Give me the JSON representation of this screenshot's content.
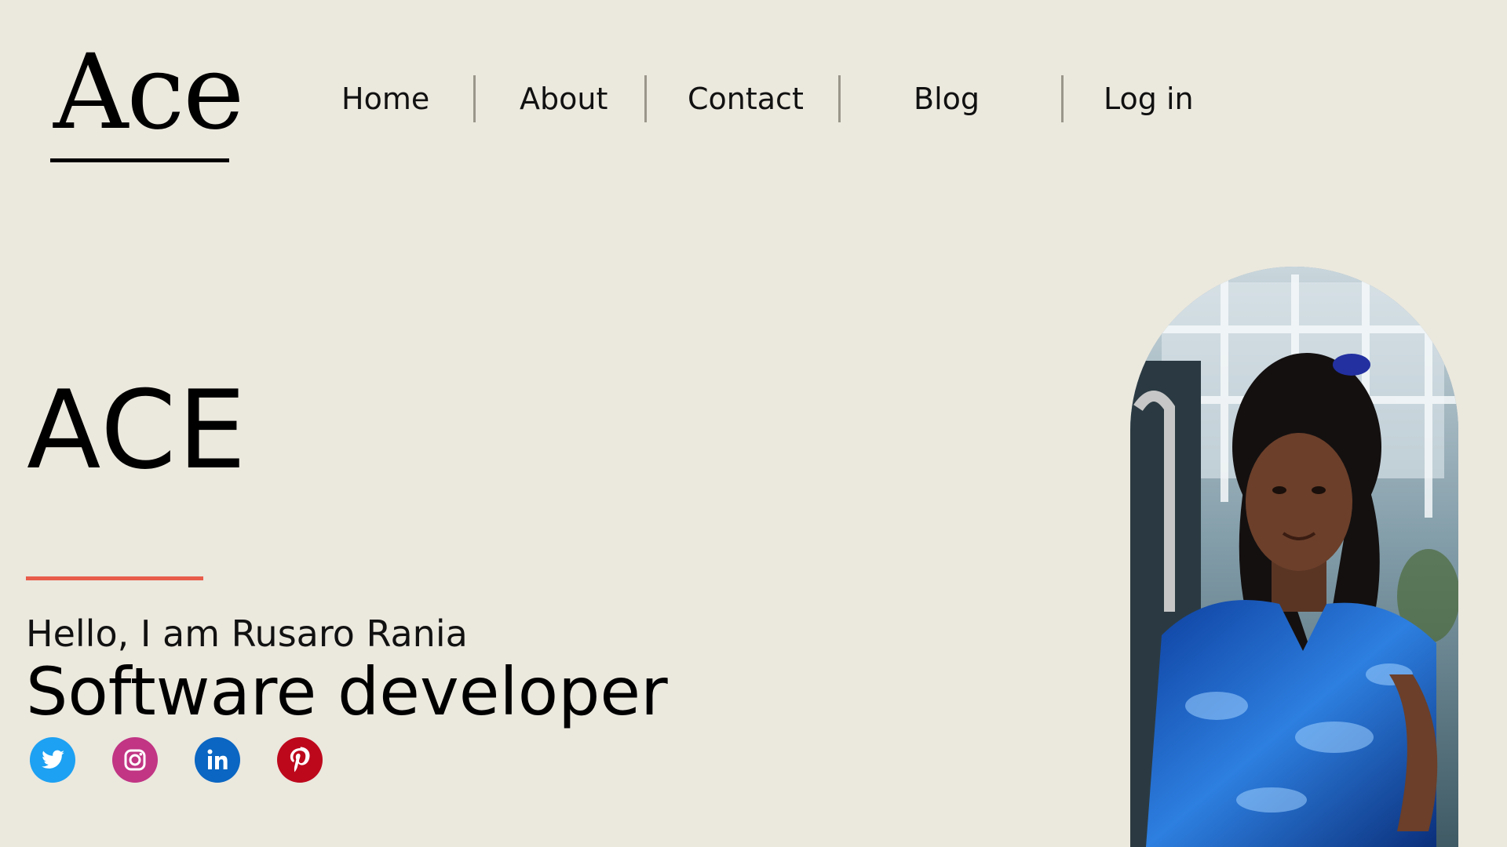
{
  "header": {
    "logo": "Ace",
    "nav": [
      {
        "label": "Home"
      },
      {
        "label": "About"
      },
      {
        "label": "Contact"
      },
      {
        "label": "Blog"
      },
      {
        "label": "Log in"
      }
    ]
  },
  "hero": {
    "title": "ACE",
    "greeting": "Hello, I am Rusaro Rania",
    "role": "Software developer",
    "accent_color": "#e85c4a"
  },
  "socials": [
    {
      "icon": "twitter-icon",
      "color": "#1da1f2"
    },
    {
      "icon": "instagram-icon",
      "color": "#c13584"
    },
    {
      "icon": "linkedin-icon",
      "color": "#0a66c2"
    },
    {
      "icon": "pinterest-icon",
      "color": "#bd081c"
    }
  ],
  "profile_photo": {
    "icon": "profile-photo"
  },
  "colors": {
    "background": "#ebe8de",
    "text": "#000000",
    "accent": "#e85c4a"
  }
}
